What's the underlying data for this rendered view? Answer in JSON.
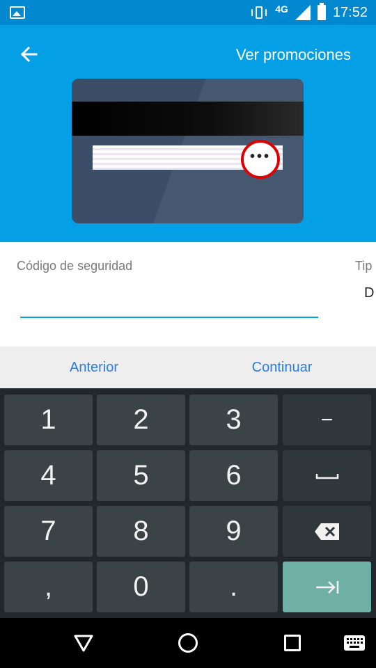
{
  "status_bar": {
    "network_type": "4G",
    "time": "17:52",
    "icons": [
      "image-icon",
      "vibrate-icon",
      "signal-icon",
      "battery-icon"
    ]
  },
  "header": {
    "back_icon": "arrow-left-icon",
    "promotions_link": "Ver promociones",
    "background_color": "#049fe5"
  },
  "card_illustration": {
    "highlight_dots": "•••",
    "highlight_color": "#e00000"
  },
  "form": {
    "security_code_label": "Código de seguridad",
    "security_code_value": "",
    "type_label": "Tip",
    "type_value": "D",
    "accent_color": "#049fe5"
  },
  "navigation": {
    "previous_label": "Anterior",
    "continue_label": "Continuar",
    "link_color": "#2a7de1"
  },
  "keyboard": {
    "keys": [
      "1",
      "2",
      "3",
      "−",
      "4",
      "5",
      "6",
      "␣",
      "7",
      "8",
      "9",
      "⌫",
      ",",
      "0",
      ".",
      "⇥"
    ],
    "key_names": [
      "key-1",
      "key-2",
      "key-3",
      "key-minus",
      "key-4",
      "key-5",
      "key-6",
      "key-space",
      "key-7",
      "key-8",
      "key-9",
      "key-backspace",
      "key-comma",
      "key-0",
      "key-period",
      "key-next"
    ]
  },
  "system_nav": {
    "icons": [
      "back-triangle-icon",
      "home-circle-icon",
      "recents-square-icon",
      "keyboard-icon"
    ]
  }
}
